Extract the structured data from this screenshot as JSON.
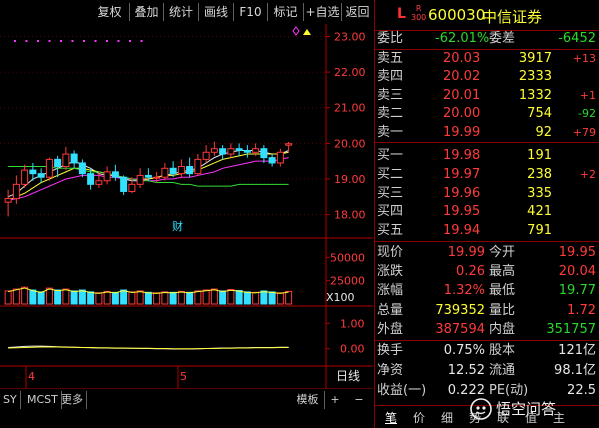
{
  "toolbar": {
    "buttons": [
      "复权",
      "叠加",
      "统计",
      "画线",
      "F10",
      "标记",
      "+自选",
      "返回"
    ]
  },
  "chart_data": [
    {
      "type": "candlestick",
      "panel": "price",
      "y_ticks": [
        "23.00",
        "22.00",
        "21.00",
        "20.00",
        "19.00",
        "18.00"
      ],
      "ylim": [
        17.4,
        23.35
      ],
      "annotation": "财",
      "x_labels": [
        "4",
        "5"
      ],
      "candles": [
        {
          "o": 18.35,
          "c": 18.45,
          "h": 18.7,
          "l": 17.95
        },
        {
          "o": 18.45,
          "c": 18.85,
          "h": 19.1,
          "l": 18.3
        },
        {
          "o": 18.85,
          "c": 19.25,
          "h": 19.4,
          "l": 18.75
        },
        {
          "o": 19.25,
          "c": 19.15,
          "h": 19.45,
          "l": 18.95
        },
        {
          "o": 19.15,
          "c": 19.05,
          "h": 19.3,
          "l": 18.9
        },
        {
          "o": 19.05,
          "c": 19.55,
          "h": 19.6,
          "l": 18.95
        },
        {
          "o": 19.55,
          "c": 19.35,
          "h": 19.65,
          "l": 19.05
        },
        {
          "o": 19.35,
          "c": 19.7,
          "h": 19.9,
          "l": 19.25
        },
        {
          "o": 19.7,
          "c": 19.45,
          "h": 19.8,
          "l": 19.3
        },
        {
          "o": 19.45,
          "c": 19.15,
          "h": 19.55,
          "l": 19.05
        },
        {
          "o": 19.15,
          "c": 18.85,
          "h": 19.3,
          "l": 18.7
        },
        {
          "o": 18.85,
          "c": 18.95,
          "h": 19.2,
          "l": 18.75
        },
        {
          "o": 18.95,
          "c": 19.2,
          "h": 19.35,
          "l": 18.85
        },
        {
          "o": 19.2,
          "c": 19.05,
          "h": 19.4,
          "l": 18.95
        },
        {
          "o": 19.05,
          "c": 18.65,
          "h": 19.1,
          "l": 18.55
        },
        {
          "o": 18.65,
          "c": 18.85,
          "h": 19.05,
          "l": 18.6
        },
        {
          "o": 18.85,
          "c": 19.1,
          "h": 19.3,
          "l": 18.75
        },
        {
          "o": 19.1,
          "c": 19.05,
          "h": 19.3,
          "l": 18.95
        },
        {
          "o": 19.05,
          "c": 19.05,
          "h": 19.2,
          "l": 18.9
        },
        {
          "o": 19.05,
          "c": 19.3,
          "h": 19.45,
          "l": 18.95
        },
        {
          "o": 19.3,
          "c": 19.15,
          "h": 19.5,
          "l": 19.05
        },
        {
          "o": 19.15,
          "c": 19.35,
          "h": 19.55,
          "l": 19.05
        },
        {
          "o": 19.35,
          "c": 19.15,
          "h": 19.6,
          "l": 19.05
        },
        {
          "o": 19.15,
          "c": 19.55,
          "h": 19.7,
          "l": 19.1
        },
        {
          "o": 19.55,
          "c": 19.75,
          "h": 19.95,
          "l": 19.45
        },
        {
          "o": 19.75,
          "c": 19.85,
          "h": 20.05,
          "l": 19.65
        },
        {
          "o": 19.85,
          "c": 19.7,
          "h": 19.95,
          "l": 19.55
        },
        {
          "o": 19.7,
          "c": 19.85,
          "h": 20.0,
          "l": 19.6
        },
        {
          "o": 19.85,
          "c": 19.8,
          "h": 20.0,
          "l": 19.65
        },
        {
          "o": 19.8,
          "c": 19.75,
          "h": 19.95,
          "l": 19.6
        },
        {
          "o": 19.75,
          "c": 19.85,
          "h": 20.0,
          "l": 19.65
        },
        {
          "o": 19.85,
          "c": 19.6,
          "h": 19.95,
          "l": 19.45
        },
        {
          "o": 19.6,
          "c": 19.45,
          "h": 19.7,
          "l": 19.35
        },
        {
          "o": 19.45,
          "c": 19.75,
          "h": 19.85,
          "l": 19.35
        },
        {
          "o": 19.95,
          "c": 19.99,
          "h": 20.04,
          "l": 19.77
        }
      ],
      "ma": [
        {
          "color": "#e8e8e8",
          "values": [
            18.5,
            18.6,
            18.8,
            19.0,
            19.1,
            19.2,
            19.3,
            19.4,
            19.5,
            19.4,
            19.3,
            19.15,
            19.1,
            19.1,
            19.0,
            18.95,
            18.95,
            19.0,
            19.05,
            19.1,
            19.15,
            19.2,
            19.25,
            19.3,
            19.45,
            19.6,
            19.7,
            19.75,
            19.8,
            19.8,
            19.8,
            19.75,
            19.7,
            19.7,
            19.8
          ]
        },
        {
          "color": "#ffff33",
          "values": [
            18.4,
            18.5,
            18.6,
            18.75,
            18.9,
            19.0,
            19.1,
            19.2,
            19.3,
            19.3,
            19.25,
            19.2,
            19.15,
            19.1,
            19.05,
            19.0,
            19.0,
            19.0,
            19.05,
            19.1,
            19.1,
            19.15,
            19.2,
            19.25,
            19.35,
            19.45,
            19.55,
            19.6,
            19.65,
            19.7,
            19.7,
            19.7,
            19.7,
            19.7,
            19.75
          ]
        },
        {
          "color": "#ff33ff",
          "values": [
            18.4,
            18.45,
            18.5,
            18.6,
            18.7,
            18.8,
            18.9,
            19.0,
            19.05,
            19.1,
            19.1,
            19.1,
            19.05,
            19.05,
            19.0,
            19.0,
            19.0,
            18.95,
            18.95,
            19.0,
            19.0,
            19.05,
            19.05,
            19.1,
            19.15,
            19.2,
            19.3,
            19.35,
            19.4,
            19.45,
            19.5,
            19.5,
            19.5,
            19.55,
            19.6
          ]
        },
        {
          "color": "#33dd33",
          "values": [
            19.35,
            19.35,
            19.35,
            19.35,
            19.35,
            19.35,
            19.3,
            19.3,
            19.3,
            19.25,
            19.2,
            19.2,
            19.15,
            19.1,
            19.05,
            19.0,
            18.95,
            18.95,
            18.9,
            18.9,
            18.9,
            18.85,
            18.85,
            18.8,
            18.8,
            18.8,
            18.8,
            18.8,
            18.85,
            18.85,
            18.85,
            18.85,
            18.85,
            18.85,
            18.85
          ]
        }
      ]
    },
    {
      "type": "bar",
      "panel": "volume",
      "y_ticks": [
        "50000",
        "25000",
        "X100"
      ],
      "ylim": [
        0,
        60000
      ],
      "values": [
        14000,
        16000,
        18000,
        15000,
        13000,
        17000,
        15000,
        16000,
        14000,
        15000,
        13000,
        12000,
        13500,
        12500,
        15000,
        13000,
        14000,
        12500,
        12000,
        13000,
        12500,
        13500,
        12500,
        14000,
        15000,
        16000,
        14000,
        15500,
        14500,
        13000,
        12500,
        14000,
        13000,
        12000,
        13500
      ]
    },
    {
      "type": "line",
      "panel": "indicator",
      "y_ticks": [
        "1.00",
        "0.00"
      ],
      "ylim": [
        -0.6,
        1.6
      ],
      "series": [
        {
          "color": "#e8e8e8",
          "values": [
            0.05,
            0.07,
            0.09,
            0.1,
            0.1,
            0.09,
            0.08,
            0.07,
            0.06,
            0.05,
            0.04,
            0.03,
            0.03,
            0.02,
            0.02,
            0.02,
            0.01,
            0.01,
            0.0,
            0.0,
            -0.01,
            -0.01,
            -0.01,
            0.0,
            0.01,
            0.02,
            0.03,
            0.03,
            0.04,
            0.04,
            0.05,
            0.05,
            0.05,
            0.06,
            0.06
          ]
        },
        {
          "color": "#ffff33",
          "values": [
            0.03,
            0.04,
            0.05,
            0.06,
            0.07,
            0.07,
            0.07,
            0.06,
            0.06,
            0.05,
            0.05,
            0.04,
            0.04,
            0.03,
            0.03,
            0.02,
            0.02,
            0.02,
            0.01,
            0.01,
            0.0,
            0.0,
            0.0,
            0.0,
            0.01,
            0.01,
            0.02,
            0.02,
            0.03,
            0.03,
            0.04,
            0.04,
            0.04,
            0.05,
            0.05
          ]
        }
      ]
    }
  ],
  "bottom_bar": {
    "tabs": [
      "SY",
      "MCST",
      "更多"
    ],
    "right_label": "日线",
    "template_label": "模板",
    "plus": "+",
    "minus": "−"
  },
  "quote": {
    "letter": "L",
    "badge_top": "R",
    "badge_bottom": "300",
    "code": "600030",
    "name": "中信证券",
    "weibi_label": "委比",
    "weibi_value": "-62.01%",
    "weicha_label": "委差",
    "weicha_value": "-6452",
    "sell": [
      {
        "label": "卖五",
        "price": "20.03",
        "vol": "3917",
        "chg": "+13"
      },
      {
        "label": "卖四",
        "price": "20.02",
        "vol": "2333",
        "chg": ""
      },
      {
        "label": "卖三",
        "price": "20.01",
        "vol": "1332",
        "chg": "+1"
      },
      {
        "label": "卖二",
        "price": "20.00",
        "vol": "754",
        "chg": "-92"
      },
      {
        "label": "卖一",
        "price": "19.99",
        "vol": "92",
        "chg": "+79"
      }
    ],
    "buy": [
      {
        "label": "买一",
        "price": "19.98",
        "vol": "191",
        "chg": ""
      },
      {
        "label": "买二",
        "price": "19.97",
        "vol": "238",
        "chg": "+2"
      },
      {
        "label": "买三",
        "price": "19.96",
        "vol": "335",
        "chg": ""
      },
      {
        "label": "买四",
        "price": "19.95",
        "vol": "421",
        "chg": ""
      },
      {
        "label": "买五",
        "price": "19.94",
        "vol": "791",
        "chg": ""
      }
    ],
    "stats1": [
      {
        "l1": "现价",
        "v1": "19.99",
        "l2": "今开",
        "v2": "19.95"
      },
      {
        "l1": "涨跌",
        "v1": "0.26",
        "l2": "最高",
        "v2": "20.04"
      },
      {
        "l1": "涨幅",
        "v1": "1.32%",
        "l2": "最低",
        "v2": "19.77"
      },
      {
        "l1": "总量",
        "v1": "739352",
        "l2": "量比",
        "v2": "1.72"
      },
      {
        "l1": "外盘",
        "v1": "387594",
        "l2": "内盘",
        "v2": "351757"
      }
    ],
    "stats2": [
      {
        "l1": "换手",
        "v1": "0.75%",
        "l2": "股本",
        "v2": "121亿"
      },
      {
        "l1": "净资",
        "v1": "12.52",
        "l2": "流通",
        "v2": "98.1亿"
      },
      {
        "l1": "收益(一)",
        "v1": "0.222",
        "l2": "PE(动)",
        "v2": "22.5"
      }
    ],
    "tabs": [
      "笔",
      "价",
      "细",
      "势",
      "联",
      "值",
      "主"
    ]
  },
  "watermark": "悟空问答"
}
